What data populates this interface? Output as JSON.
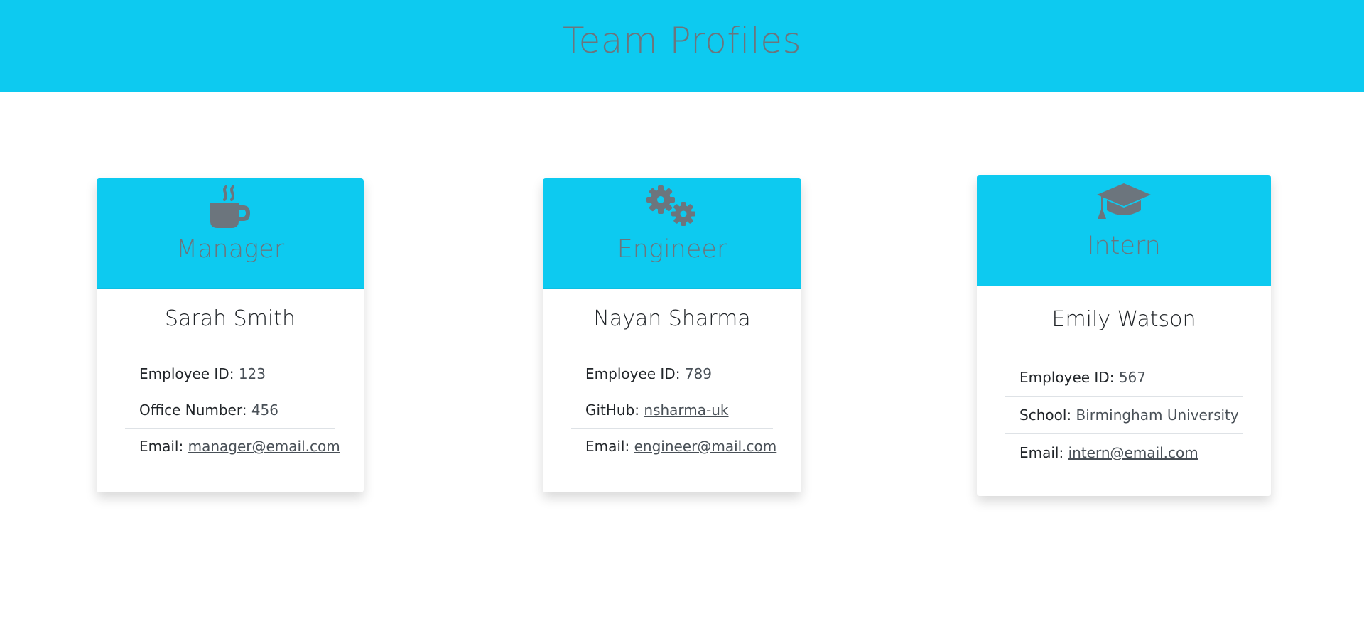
{
  "header": {
    "title": "Team Profiles"
  },
  "colors": {
    "accent": "#0dcaf0",
    "muted_text": "#6c757d"
  },
  "cards": [
    {
      "role": "Manager",
      "icon": "coffee-mug-icon",
      "name": "Sarah Smith",
      "fields": [
        {
          "label": "Employee ID:",
          "value": "123"
        },
        {
          "label": "Office Number:",
          "value": "456"
        },
        {
          "label": "Email:",
          "value": "manager@email.com"
        }
      ]
    },
    {
      "role": "Engineer",
      "icon": "gears-icon",
      "name": "Nayan Sharma",
      "fields": [
        {
          "label": "Employee ID:",
          "value": "789"
        },
        {
          "label": "GitHub:",
          "value": "nsharma-uk"
        },
        {
          "label": "Email:",
          "value": "engineer@mail.com"
        }
      ]
    },
    {
      "role": "Intern",
      "icon": "graduation-cap-icon",
      "name": "Emily Watson",
      "fields": [
        {
          "label": "Employee ID:",
          "value": "567"
        },
        {
          "label": "School:",
          "value": "Birmingham University"
        },
        {
          "label": "Email:",
          "value": "intern@email.com"
        }
      ]
    }
  ]
}
